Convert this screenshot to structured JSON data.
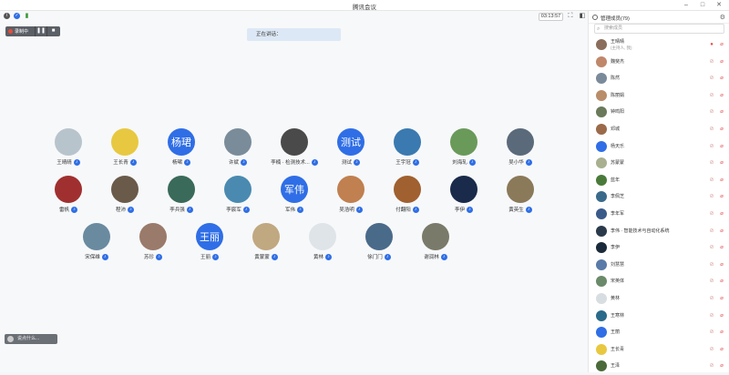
{
  "window": {
    "title": "腾讯会议"
  },
  "toolbar": {
    "timer": "03:13:57"
  },
  "recording": {
    "label": "录制中"
  },
  "notice": {
    "text": "正在讲话："
  },
  "chat_mini": {
    "label": "说点什么..."
  },
  "panel": {
    "title": "管理成员(79)",
    "search_placeholder": "搜索成员",
    "members": [
      {
        "name": "王晴晴",
        "sub": "(主持人, 我)",
        "color": "#8a6d5a"
      },
      {
        "name": "魏斐杰",
        "sub": "",
        "color": "#c0876a"
      },
      {
        "name": "陈然",
        "sub": "",
        "color": "#7a8a9a"
      },
      {
        "name": "陈丽娟",
        "sub": "",
        "color": "#b98d6a"
      },
      {
        "name": "钟鸣阳",
        "sub": "",
        "color": "#6a7a5a"
      },
      {
        "name": "邓城",
        "sub": "",
        "color": "#9a6a4a"
      },
      {
        "name": "杨天乐",
        "sub": "",
        "color": "#2f6ee6"
      },
      {
        "name": "苏蒙蒙",
        "sub": "",
        "color": "#a8b090"
      },
      {
        "name": "蓝年",
        "sub": "",
        "color": "#4a7a3a"
      },
      {
        "name": "李佩芝",
        "sub": "",
        "color": "#3a6a8a"
      },
      {
        "name": "李年军",
        "sub": "",
        "color": "#3a5a8a"
      },
      {
        "name": "李伟 · 智能技术与自动化系统",
        "sub": "",
        "color": "#2a3a4a"
      },
      {
        "name": "李伊",
        "sub": "",
        "color": "#1a2a3a"
      },
      {
        "name": "刘慧慧",
        "sub": "",
        "color": "#5a7aa8"
      },
      {
        "name": "宋英体",
        "sub": "",
        "color": "#6a8a6a"
      },
      {
        "name": "黄林",
        "sub": "",
        "color": "#d8dde2"
      },
      {
        "name": "王寒林",
        "sub": "",
        "color": "#2a6a8a"
      },
      {
        "name": "王丽",
        "sub": "",
        "color": "#2f6ee6"
      },
      {
        "name": "王长青",
        "sub": "",
        "color": "#e8c840"
      },
      {
        "name": "王泽",
        "sub": "",
        "color": "#4a6a3a"
      }
    ]
  },
  "grid": [
    {
      "name": "王晴晴",
      "text": "",
      "color": "#b8c4cc"
    },
    {
      "name": "王长青",
      "text": "",
      "color": "#e8c840"
    },
    {
      "name": "杨珺",
      "text": "杨珺",
      "color": "#2f6ee6"
    },
    {
      "name": "许斌",
      "text": "",
      "color": "#7a8c9a"
    },
    {
      "name": "李楠 · 检测技术...",
      "text": "",
      "color": "#4a4a4a"
    },
    {
      "name": "测试",
      "text": "测试",
      "color": "#2f6ee6"
    },
    {
      "name": "王宇冠",
      "text": "",
      "color": "#3a7ab0"
    },
    {
      "name": "刘海轧",
      "text": "",
      "color": "#6a9a5a"
    },
    {
      "name": "吴小华",
      "text": "",
      "color": "#5a6a7a"
    },
    {
      "name": "雷帆",
      "text": "",
      "color": "#a03030"
    },
    {
      "name": "程沛",
      "text": "",
      "color": "#6a5a4a"
    },
    {
      "name": "李兵强",
      "text": "",
      "color": "#3a6a5a"
    },
    {
      "name": "李宸军",
      "text": "",
      "color": "#4a8ab0"
    },
    {
      "name": "军伟",
      "text": "军伟",
      "color": "#2f6ee6"
    },
    {
      "name": "吴浩明",
      "text": "",
      "color": "#c08050"
    },
    {
      "name": "付翻阳",
      "text": "",
      "color": "#a06030"
    },
    {
      "name": "李伊",
      "text": "",
      "color": "#1a2a4a"
    },
    {
      "name": "黄英生",
      "text": "",
      "color": "#8a7a5a"
    },
    {
      "name": "宋保维",
      "text": "",
      "color": "#6a8aa0"
    },
    {
      "name": "苏珍",
      "text": "",
      "color": "#9a7a6a"
    },
    {
      "name": "王丽",
      "text": "王丽",
      "color": "#2f6ee6"
    },
    {
      "name": "黄蒙蒙",
      "text": "",
      "color": "#c0a880"
    },
    {
      "name": "黄林",
      "text": "",
      "color": "#dfe4e8"
    },
    {
      "name": "徐门门",
      "text": "",
      "color": "#4a6a8a"
    },
    {
      "name": "谢润林",
      "text": "",
      "color": "#7a7a6a"
    }
  ]
}
